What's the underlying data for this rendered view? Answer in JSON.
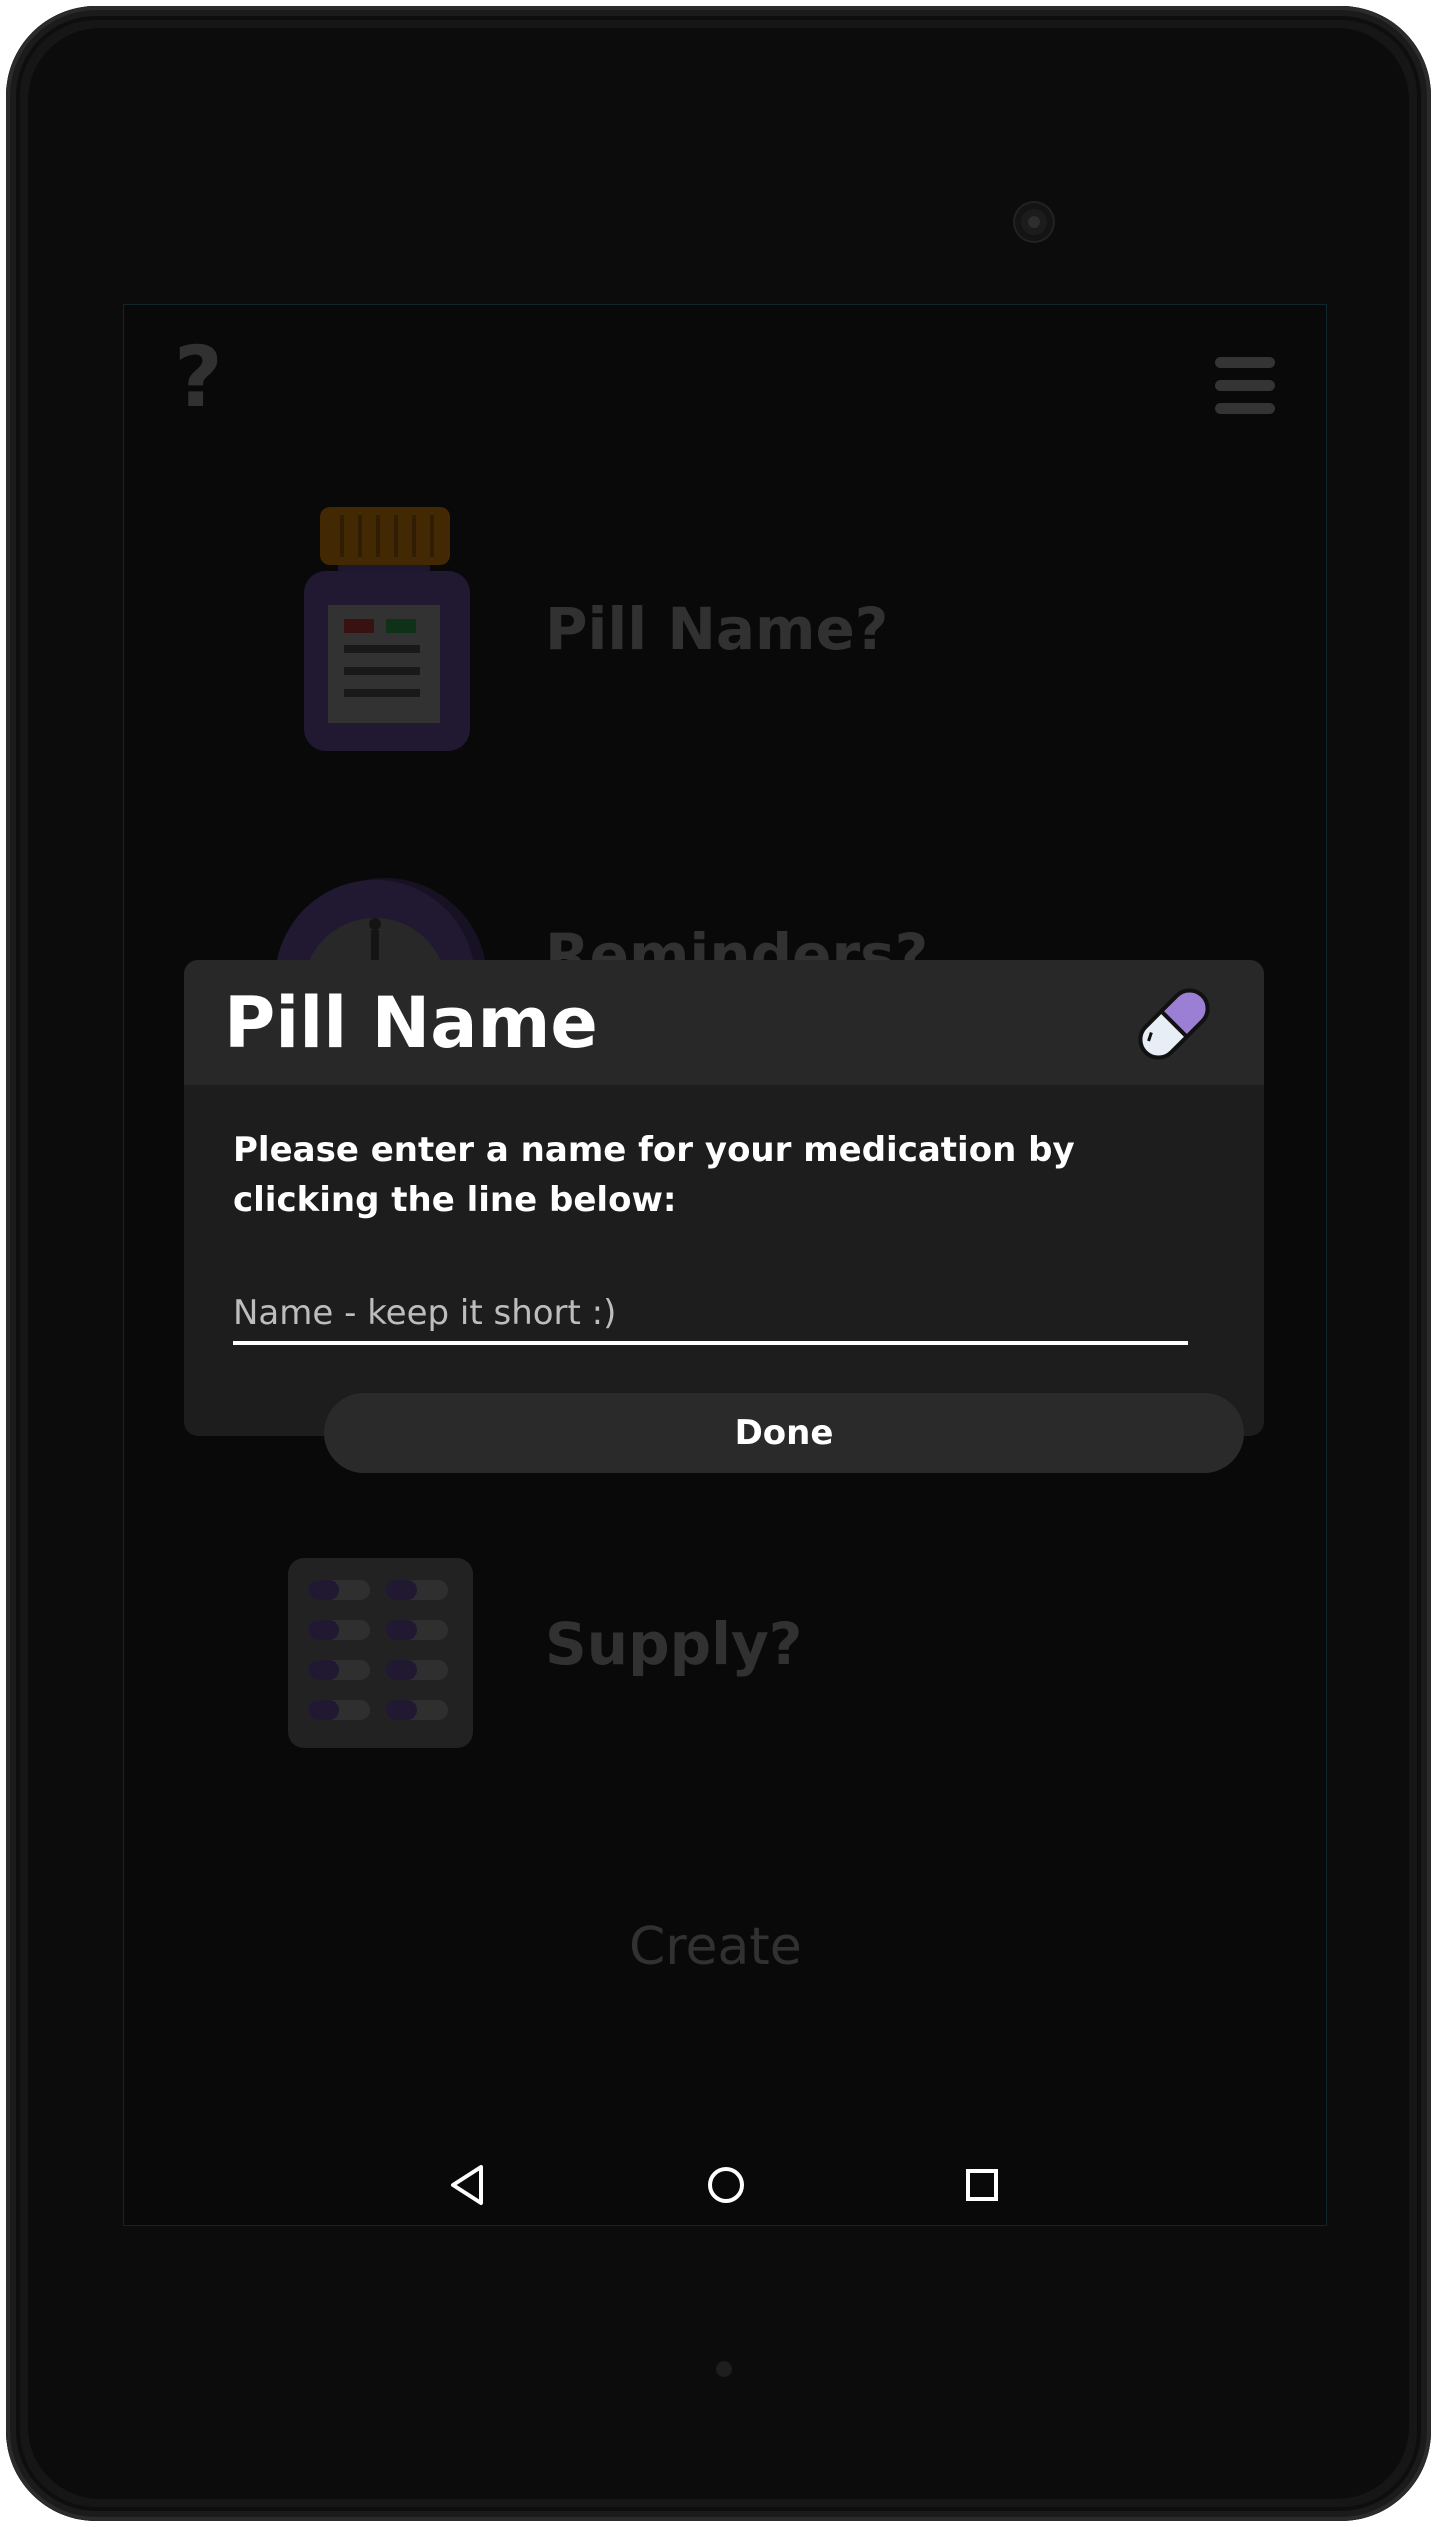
{
  "screen": {
    "rows": [
      {
        "label": "Pill Name?"
      },
      {
        "label": "Reminders?"
      },
      {
        "label": "Supply?"
      }
    ],
    "create_label": "Create"
  },
  "dialog": {
    "title": "Pill Name",
    "message": "Please enter a name for your medication by clicking the line below:",
    "input": {
      "value": "",
      "placeholder": "Name - keep it short :)"
    },
    "done_label": "Done"
  },
  "icons": {
    "help": "question-mark-icon",
    "menu": "hamburger-menu-icon",
    "pill": "capsule-icon"
  },
  "colors": {
    "accent_purple": "#9b7fd4",
    "bottle_cap": "#b26a00",
    "dialog_bg": "#1d1d1d"
  }
}
